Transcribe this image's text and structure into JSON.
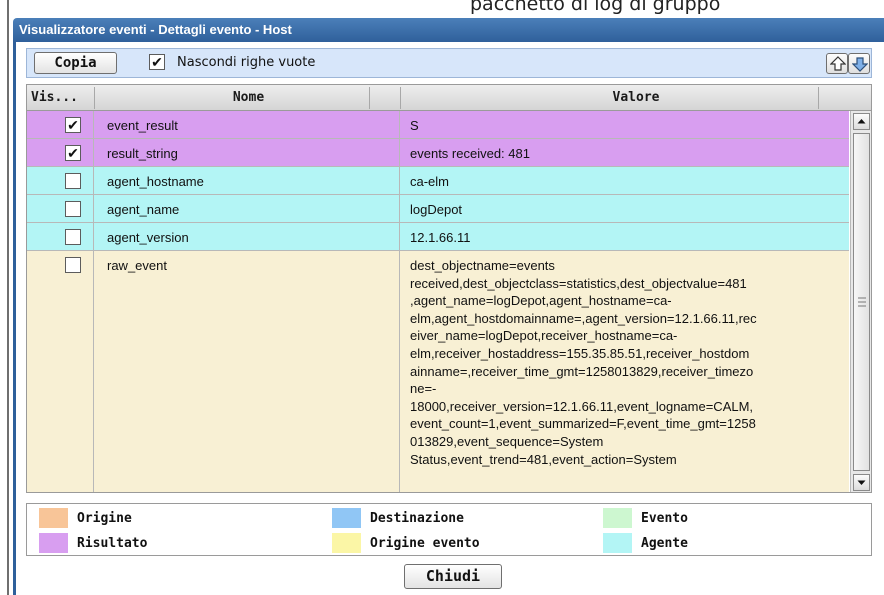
{
  "background_text": "pacchetto di log di gruppo",
  "window": {
    "title": "Visualizzatore eventi - Dettagli evento - Host"
  },
  "toolbar": {
    "copy_label": "Copia",
    "hide_empty_label": "Nascondi righe vuote",
    "hide_empty_checked": true,
    "move_up_icon": "arrow-up-icon",
    "move_down_icon": "arrow-down-icon"
  },
  "grid": {
    "columns": {
      "vis": "Vis...",
      "nome": "Nome",
      "valore": "Valore"
    },
    "rows": [
      {
        "checked": true,
        "name": "event_result",
        "value": "S",
        "color": "#d89ef0"
      },
      {
        "checked": true,
        "name": "result_string",
        "value": "events received: 481",
        "color": "#d89ef0"
      },
      {
        "checked": false,
        "name": "agent_hostname",
        "value": "ca-elm",
        "color": "#b3f5f5"
      },
      {
        "checked": false,
        "name": "agent_name",
        "value": "logDepot",
        "color": "#b3f5f5"
      },
      {
        "checked": false,
        "name": "agent_version",
        "value": "12.1.66.11",
        "color": "#b3f5f5"
      },
      {
        "checked": false,
        "name": "raw_event",
        "value": "dest_objectname=events\nreceived,dest_objectclass=statistics,dest_objectvalue=481\n,agent_name=logDepot,agent_hostname=ca-\nelm,agent_hostdomainname=,agent_version=12.1.66.11,rec\neiver_name=logDepot,receiver_hostname=ca-\nelm,receiver_hostaddress=155.35.85.51,receiver_hostdom\nainname=,receiver_time_gmt=1258013829,receiver_timezo\nne=-\n18000,receiver_version=12.1.66.11,event_logname=CALM,\nevent_count=1,event_summarized=F,event_time_gmt=1258\n013829,event_sequence=System\nStatus,event_trend=481,event_action=System",
        "color": "#f8f0d4"
      }
    ]
  },
  "legend": {
    "items": [
      {
        "label": "Origine",
        "color": "#f8c598"
      },
      {
        "label": "Destinazione",
        "color": "#90c6f5"
      },
      {
        "label": "Evento",
        "color": "#cdf7d0"
      },
      {
        "label": "Risultato",
        "color": "#d89ef0"
      },
      {
        "label": "Origine evento",
        "color": "#fbf6a6"
      },
      {
        "label": "Agente",
        "color": "#b3f5f5"
      }
    ]
  },
  "footer": {
    "close_label": "Chiudi"
  }
}
